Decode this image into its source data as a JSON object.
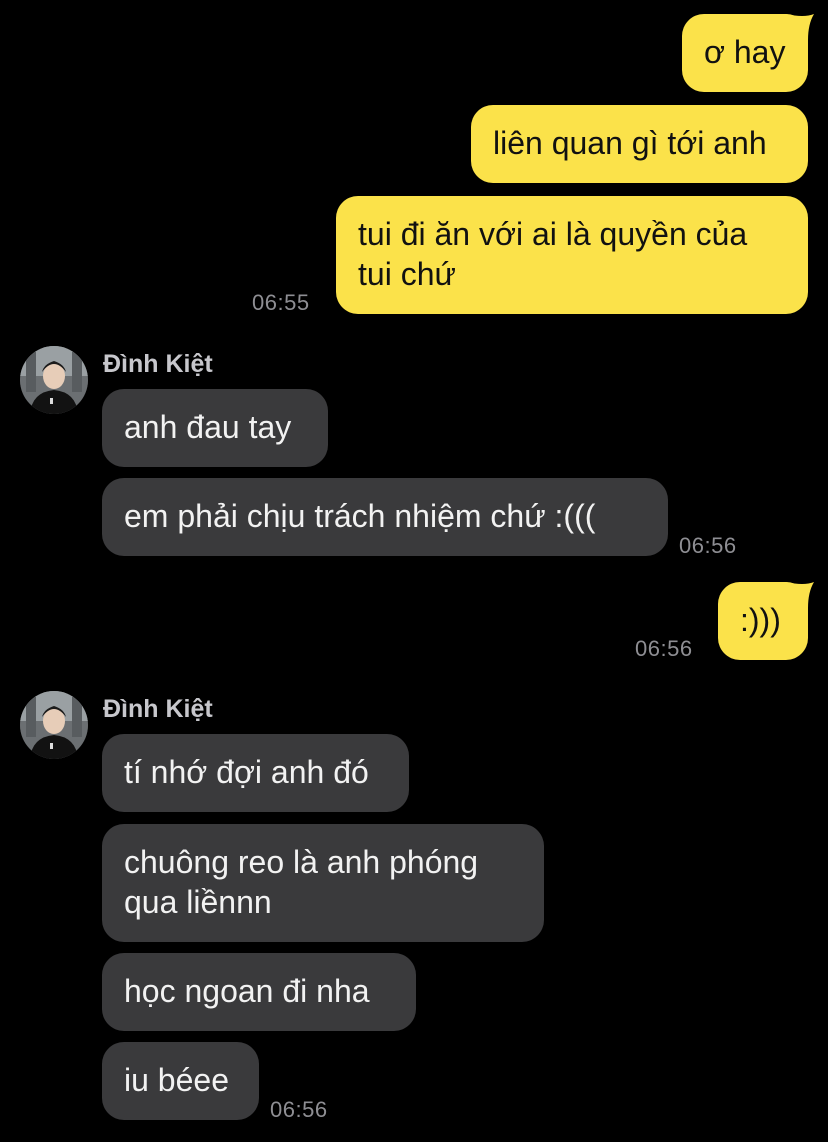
{
  "colors": {
    "background": "#000000",
    "outgoing_bubble": "#FBE24A",
    "incoming_bubble": "#3A3A3C",
    "timestamp": "#8E8E93",
    "sender_name": "#C7C7CC"
  },
  "messages": {
    "out1": "ơ hay",
    "out2": "liên quan gì tới anh",
    "out3": "tui đi ăn với ai là quyền của\ntui chứ",
    "out3_time": "06:55",
    "group1_sender": "Đình Kiệt",
    "in1": "anh đau tay",
    "in2": "em phải chịu trách nhiệm chứ :(((",
    "in2_time": "06:56",
    "out4": ":)))",
    "out4_time": "06:56",
    "group2_sender": "Đình Kiệt",
    "in3": "tí nhớ đợi anh đó",
    "in4": "chuông reo là anh phóng\nqua liềnnn",
    "in5": "học ngoan đi nha",
    "in6": "iu béee",
    "in6_time": "06:56"
  },
  "avatar_icon": "user-avatar-photo"
}
